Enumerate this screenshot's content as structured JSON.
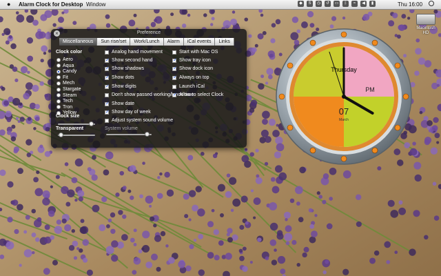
{
  "menubar": {
    "app_name": "Alarm Clock for Desktop",
    "menu_window": "Window",
    "clock": "Thu 16:00"
  },
  "desktop": {
    "drive_label": "Macintosh HD"
  },
  "pref": {
    "title": "Preference",
    "tabs": [
      "Miscellaneous",
      "Sun rise/set",
      "Work/Lunch",
      "Alarm",
      "iCal events",
      "Links"
    ],
    "clock_color_title": "Clock color",
    "colors": [
      "Aero",
      "Aqua",
      "Candy",
      "Fit",
      "Mech",
      "Stargate",
      "Steam",
      "Tech",
      "Tron",
      "Yellow"
    ],
    "selected_color": "Candy",
    "clock_size_label": "Clock size",
    "transparent_label": "Transparent",
    "system_volume_label": "System volume",
    "clock_size_value": 0.95,
    "transparent_value": 0.02,
    "system_volume_value": 0.95,
    "options_left": [
      {
        "label": "Analog hand movement",
        "checked": false
      },
      {
        "label": "Show second hand",
        "checked": true
      },
      {
        "label": "Show shadows",
        "checked": true
      },
      {
        "label": "Show dots",
        "checked": true
      },
      {
        "label": "Show digits",
        "checked": true
      },
      {
        "label": "Don't show passed working/lunch time",
        "checked": false
      },
      {
        "label": "Show date",
        "checked": true
      },
      {
        "label": "Show day of week",
        "checked": true
      },
      {
        "label": "Adjust system sound volume",
        "checked": false
      }
    ],
    "options_right": [
      {
        "label": "Start with Mac OS",
        "checked": false
      },
      {
        "label": "Show tray icon",
        "checked": true
      },
      {
        "label": "Show dock icon",
        "checked": true
      },
      {
        "label": "Always on top",
        "checked": true
      },
      {
        "label": "Launch iCal",
        "checked": false
      },
      {
        "label": "Allow to select Clock",
        "checked": true
      }
    ]
  },
  "clock": {
    "weekday": "Thursday",
    "ampm": "PM",
    "day": "07",
    "month": "March",
    "hour": 16,
    "minute": 0,
    "second": 57,
    "colors": {
      "rim": "#8a949c",
      "quad_tl": "#c9cc2e",
      "quad_tr": "#f1a6c2",
      "quad_bl": "#f08a1e",
      "quad_br": "#c2d12a",
      "marker": "#f08a1e"
    }
  }
}
